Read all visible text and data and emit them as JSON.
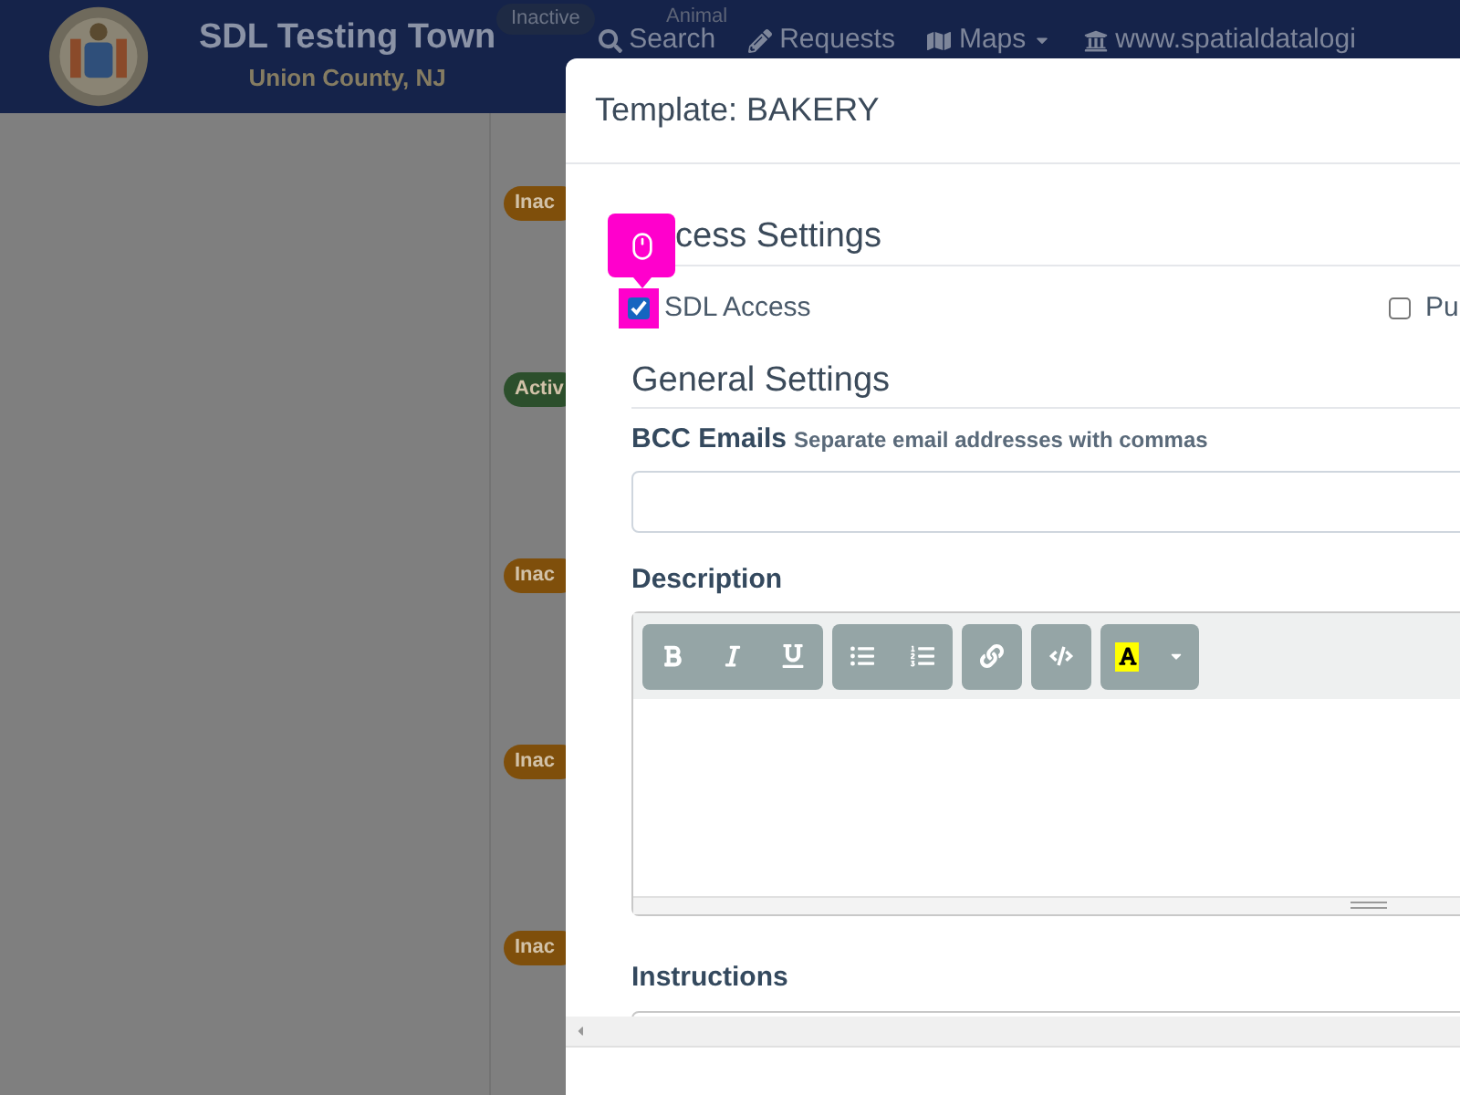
{
  "header": {
    "title": "SDL Testing Town",
    "subtitle": "Union County, NJ",
    "top_badge": "Inactive",
    "top_label": "Animal",
    "nav": [
      {
        "label": "Search"
      },
      {
        "label": "Requests"
      },
      {
        "label": "Maps",
        "dropdown": true
      },
      {
        "label": "www.spatialdatalogi"
      }
    ]
  },
  "list": {
    "badges": [
      {
        "label": "Inac",
        "kind": "inactive"
      },
      {
        "label": "Activ",
        "kind": "active"
      },
      {
        "label": "Inac",
        "kind": "inactive"
      },
      {
        "label": "Inac",
        "kind": "inactive"
      },
      {
        "label": "Inac",
        "kind": "inactive"
      }
    ]
  },
  "modal": {
    "title": "Template: BAKERY",
    "access": {
      "heading": "cess Settings",
      "options": [
        {
          "label": "SDL Access",
          "checked": true,
          "highlighted": true
        },
        {
          "label": "Pu",
          "checked": false,
          "highlighted": false
        }
      ]
    },
    "general": {
      "heading": "General Settings",
      "bcc_label": "BCC Emails",
      "bcc_hint": "Separate email addresses with commas",
      "description_label": "Description",
      "instructions_label": "Instructions"
    }
  }
}
